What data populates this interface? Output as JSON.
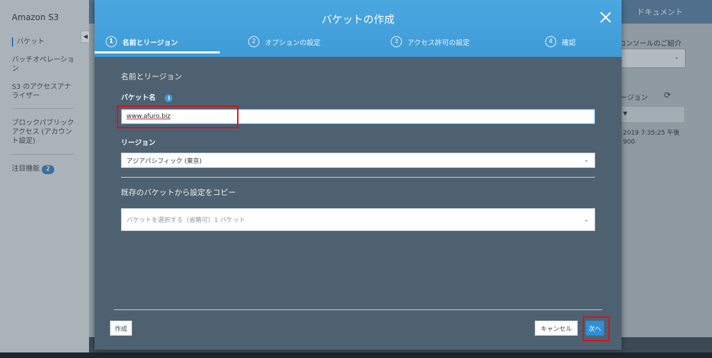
{
  "sidebar": {
    "brand": "Amazon S3",
    "items": [
      {
        "label": "バケット"
      },
      {
        "label": "バッチオペレーション"
      },
      {
        "label": "S3 のアクセスアナライザー"
      },
      {
        "label": "ブロックパブリックアクセス (アカウント設定)"
      },
      {
        "label": "注目機能",
        "badge": "2"
      }
    ]
  },
  "background": {
    "docs_link": "ドキュメント",
    "console_intro": "コンソールのご紹介",
    "region_col": "ージョン",
    "date_line1": "2019 7:35:25 午後",
    "date_line2": "900"
  },
  "modal": {
    "title": "バケットの作成",
    "steps": [
      {
        "num": "1",
        "label": "名前とリージョン"
      },
      {
        "num": "2",
        "label": "オプションの設定"
      },
      {
        "num": "3",
        "label": "アクセス許可の設定"
      },
      {
        "num": "4",
        "label": "確認"
      }
    ],
    "section_title": "名前とリージョン",
    "bucket_name_label": "バケット名",
    "bucket_name_value": "www.afuro.biz",
    "region_label": "リージョン",
    "region_value": "アジアパシフィック (東京)",
    "copy_section_title": "既存のバケットから設定をコピー",
    "copy_placeholder": "バケットを選択する（省略可）1 バケット",
    "create_button": "作成",
    "cancel_button": "キャンセル",
    "next_button": "次へ"
  },
  "colors": {
    "header": "#3f9bd6",
    "modal_body": "#4e6170",
    "highlight": "#d9101e",
    "primary_button": "#2f8fd8"
  }
}
